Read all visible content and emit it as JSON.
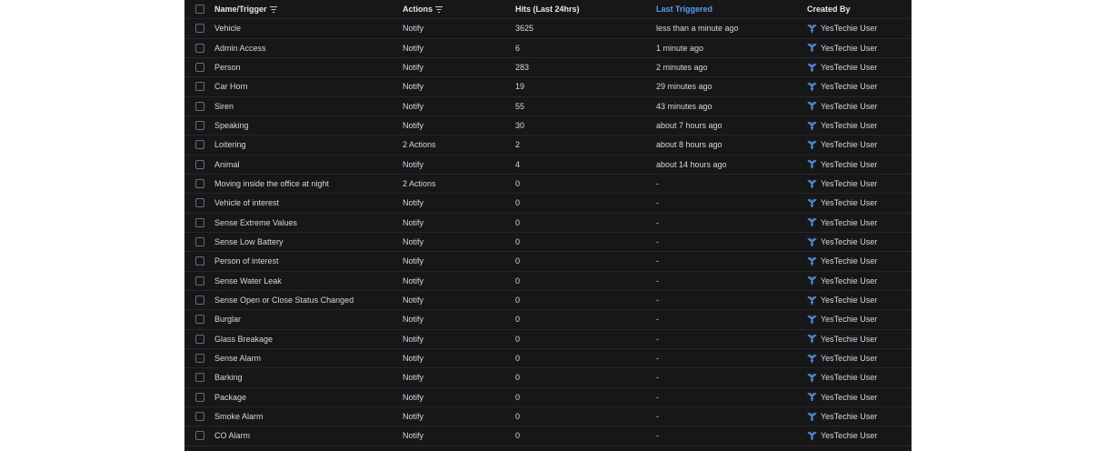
{
  "accent_color": "#5b9cf0",
  "header": {
    "name": "Name/Trigger",
    "actions": "Actions",
    "hits": "Hits (Last 24hrs)",
    "last": "Last Triggered",
    "created": "Created By"
  },
  "rows": [
    {
      "name": "Vehicle",
      "actions": "Notify",
      "hits": "3625",
      "last": "less than a minute ago",
      "created": "YesTechie User"
    },
    {
      "name": "Admin Access",
      "actions": "Notify",
      "hits": "6",
      "last": "1 minute ago",
      "created": "YesTechie User"
    },
    {
      "name": "Person",
      "actions": "Notify",
      "hits": "283",
      "last": "2 minutes ago",
      "created": "YesTechie User"
    },
    {
      "name": "Car Horn",
      "actions": "Notify",
      "hits": "19",
      "last": "29 minutes ago",
      "created": "YesTechie User"
    },
    {
      "name": "Siren",
      "actions": "Notify",
      "hits": "55",
      "last": "43 minutes ago",
      "created": "YesTechie User"
    },
    {
      "name": "Speaking",
      "actions": "Notify",
      "hits": "30",
      "last": "about 7 hours ago",
      "created": "YesTechie User"
    },
    {
      "name": "Loitering",
      "actions": "2 Actions",
      "hits": "2",
      "last": "about 8 hours ago",
      "created": "YesTechie User"
    },
    {
      "name": "Animal",
      "actions": "Notify",
      "hits": "4",
      "last": "about 14 hours ago",
      "created": "YesTechie User"
    },
    {
      "name": "Moving inside the office at night",
      "actions": "2 Actions",
      "hits": "0",
      "last": "-",
      "created": "YesTechie User"
    },
    {
      "name": "Vehicle of interest",
      "actions": "Notify",
      "hits": "0",
      "last": "-",
      "created": "YesTechie User"
    },
    {
      "name": "Sense Extreme Values",
      "actions": "Notify",
      "hits": "0",
      "last": "-",
      "created": "YesTechie User"
    },
    {
      "name": "Sense Low Battery",
      "actions": "Notify",
      "hits": "0",
      "last": "-",
      "created": "YesTechie User"
    },
    {
      "name": "Person of interest",
      "actions": "Notify",
      "hits": "0",
      "last": "-",
      "created": "YesTechie User"
    },
    {
      "name": "Sense Water Leak",
      "actions": "Notify",
      "hits": "0",
      "last": "-",
      "created": "YesTechie User"
    },
    {
      "name": "Sense Open or Close Status Changed",
      "actions": "Notify",
      "hits": "0",
      "last": "-",
      "created": "YesTechie User"
    },
    {
      "name": "Burglar",
      "actions": "Notify",
      "hits": "0",
      "last": "-",
      "created": "YesTechie User"
    },
    {
      "name": "Glass Breakage",
      "actions": "Notify",
      "hits": "0",
      "last": "-",
      "created": "YesTechie User"
    },
    {
      "name": "Sense Alarm",
      "actions": "Notify",
      "hits": "0",
      "last": "-",
      "created": "YesTechie User"
    },
    {
      "name": "Barking",
      "actions": "Notify",
      "hits": "0",
      "last": "-",
      "created": "YesTechie User"
    },
    {
      "name": "Package",
      "actions": "Notify",
      "hits": "0",
      "last": "-",
      "created": "YesTechie User"
    },
    {
      "name": "Smoke Alarm",
      "actions": "Notify",
      "hits": "0",
      "last": "-",
      "created": "YesTechie User"
    },
    {
      "name": "CO Alarm",
      "actions": "Notify",
      "hits": "0",
      "last": "-",
      "created": "YesTechie User"
    }
  ]
}
